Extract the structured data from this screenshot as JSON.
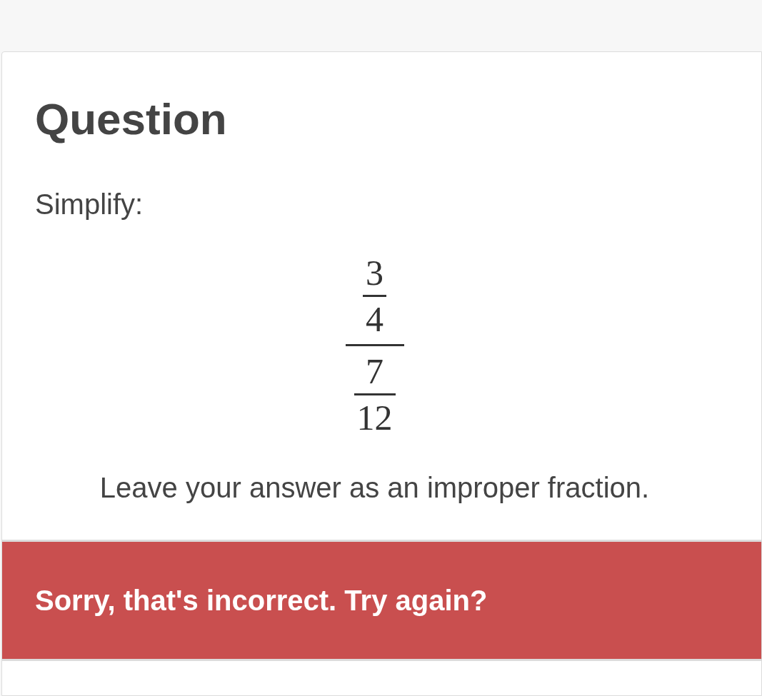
{
  "card": {
    "title": "Question",
    "prompt": "Simplify:",
    "expression": {
      "numerator": {
        "numerator": "3",
        "denominator": "4"
      },
      "denominator": {
        "numerator": "7",
        "denominator": "12"
      }
    },
    "instruction": "Leave your answer as an improper fraction."
  },
  "feedback": {
    "kind": "incorrect",
    "message": "Sorry, that's incorrect. Try again?"
  }
}
